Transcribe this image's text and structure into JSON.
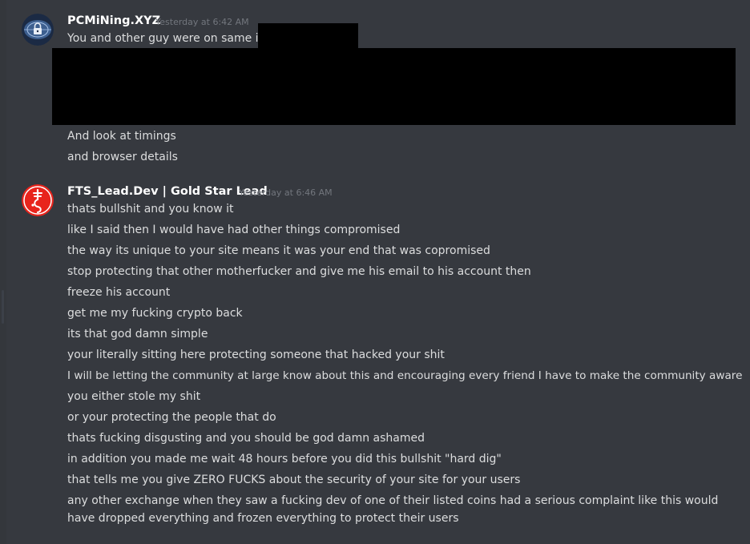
{
  "messages": [
    {
      "author": "PCMiNing.XYZ",
      "timestamp": "Yesterday at 6:42 AM",
      "avatar_icon": "lock-globe-icon",
      "lines": [
        "You and other guy were on same ip:",
        "And look at timings",
        "and browser details"
      ]
    },
    {
      "author": "FTS_Lead.Dev | Gold Star Lead",
      "timestamp": "Yesterday at 6:46 AM",
      "avatar_icon": "red-emblem-icon",
      "lines": [
        "thats bullshit and you know it",
        "like I said then I would have had other things compromised",
        "the way its unique to your site means it was your end that was copromised",
        "stop protecting that other motherfucker and give me his email to his account then",
        "freeze his account",
        "get me my fucking crypto back",
        "its that god damn simple",
        "your literally sitting here protecting someone that hacked your shit",
        "I will be letting the community at large know about this and encouraging every friend I have to make the community aware",
        "you either stole my shit",
        "or your protecting the people that do",
        "thats fucking disgusting and you should be god damn ashamed",
        "in addition you made me wait 48 hours before you did this bullshit \"hard dig\"",
        "that tells me you give ZERO FUCKS about the security of your site for your users",
        "any other exchange when they saw a fucking dev of one of their listed coins had a serious complaint like this would have dropped everything and frozen everything to protect their users"
      ]
    }
  ],
  "colors": {
    "background": "#36393f",
    "username": "#ffffff",
    "text": "#dcddde",
    "timestamp": "#72767d",
    "redaction": "#000000"
  }
}
